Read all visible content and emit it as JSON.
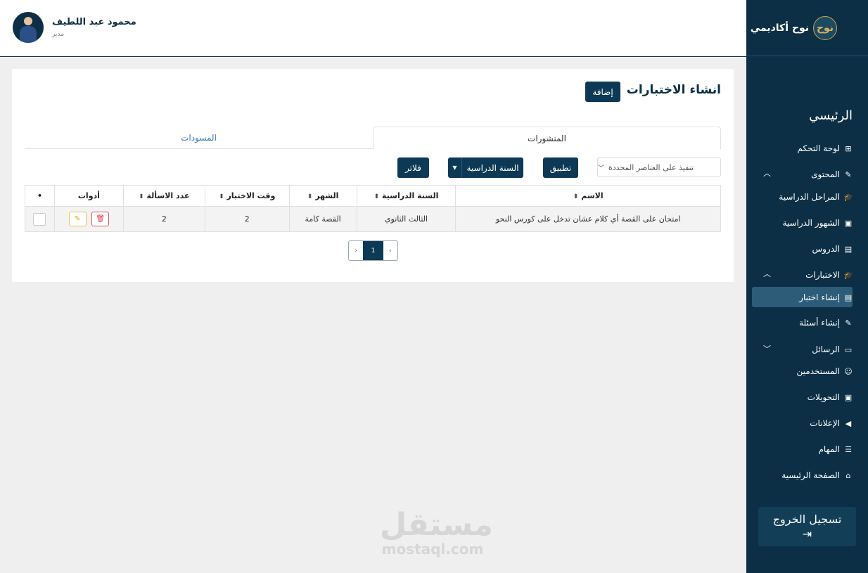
{
  "topbar": {
    "user_name": "محمود عبد اللطيف",
    "user_role": "مدير"
  },
  "sidebar": {
    "brand": "نوح أكاديمي",
    "brand_logo": "نوح",
    "section_title": "الرئيسي",
    "items": [
      {
        "label": "لوحة التحكم",
        "icon": "grid-icon"
      },
      {
        "label": "المحتوى",
        "icon": "pencil-icon",
        "chevron": "^"
      },
      {
        "label": "المراحل الدراسية",
        "icon": "graduation-cap-icon"
      },
      {
        "label": "الشهور الدراسية",
        "icon": "save-icon"
      },
      {
        "label": "الدروس",
        "icon": "file-icon"
      },
      {
        "label": "الاختبارات",
        "icon": "graduation-cap-icon",
        "chevron": "^"
      },
      {
        "label": "إنشاء اختبار",
        "icon": "file-icon"
      },
      {
        "label": "إنشاء أسئلة",
        "icon": "pencil-icon"
      },
      {
        "label": "الرسائل",
        "icon": "message-icon",
        "chevron": "v"
      },
      {
        "label": "المستخدمين",
        "icon": "user-icon"
      },
      {
        "label": "التحويلات",
        "icon": "money-icon"
      },
      {
        "label": "الإعلانات",
        "icon": "megaphone-icon"
      },
      {
        "label": "المهام",
        "icon": "list-icon"
      },
      {
        "label": "الصفحة الرئيسية",
        "icon": "home-icon"
      }
    ],
    "logout_label": "تسجيل الخروج"
  },
  "main": {
    "title": "انشاء الاختبارات",
    "add_label": "إضافة",
    "tabs": [
      {
        "label": "المنشورات"
      },
      {
        "label": "المسودات"
      }
    ],
    "bulk_action_placeholder": "تنفيذ على العناصر المحددة",
    "apply_label": "تطبيق",
    "year_filter_label": "السنة الدراسية",
    "filters_label": "فلاتر",
    "table": {
      "headers": [
        "الاسم",
        "السنة الدراسية",
        "الشهر",
        "وقت الاختبار",
        "عدد الاسألة",
        "أدوات",
        "•"
      ],
      "rows": [
        {
          "name": "امتحان على القصة أي كلام عشان تدخل على كورس النحو",
          "year": "الثالث الثانوي",
          "month": "القصة كامة",
          "time": "2",
          "count": "2"
        }
      ]
    },
    "pagination": {
      "prev": "‹",
      "current": "1",
      "next": "›"
    }
  },
  "watermark": {
    "ar": "مستقل",
    "en": "mostaql.com"
  }
}
